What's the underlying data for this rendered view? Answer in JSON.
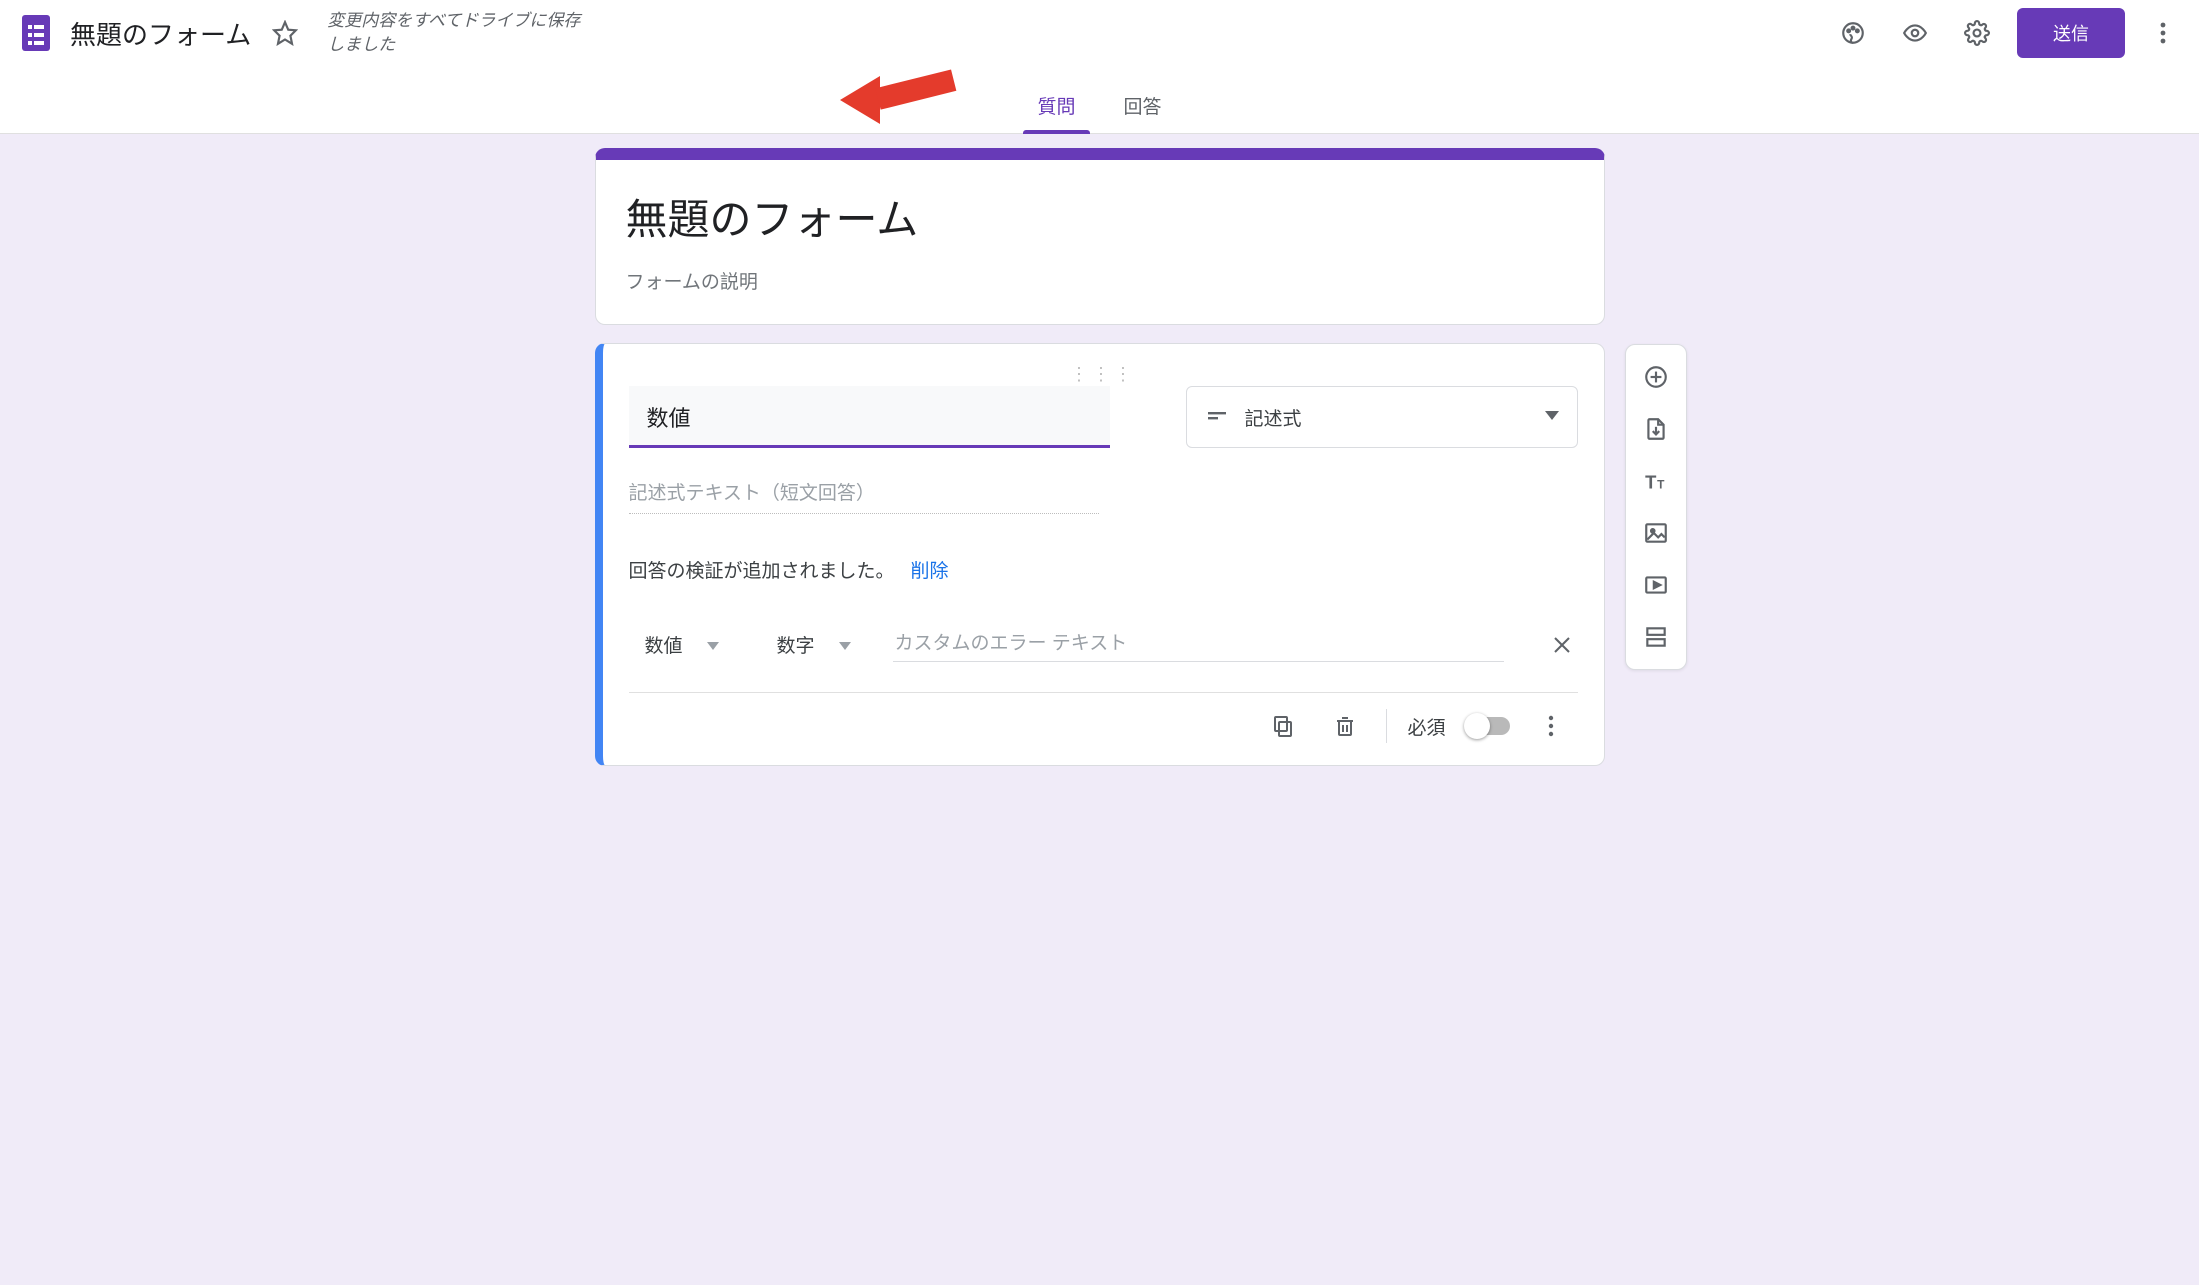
{
  "header": {
    "doc_title": "無題のフォーム",
    "save_status": "変更内容をすべてドライブに保存しました",
    "send_label": "送信"
  },
  "tabs": {
    "questions": "質問",
    "responses": "回答"
  },
  "form": {
    "title": "無題のフォーム",
    "description": "フォームの説明"
  },
  "question": {
    "title": "数値",
    "type_label": "記述式",
    "short_answer_placeholder": "記述式テキスト（短文回答）",
    "validation_added": "回答の検証が追加されました。",
    "validation_delete": "削除",
    "validation_kind": "数値",
    "validation_op": "数字",
    "error_placeholder": "カスタムのエラー テキスト",
    "required_label": "必須"
  },
  "icons": {
    "palette": "palette-icon",
    "preview": "eye-icon",
    "settings": "gear-icon",
    "more": "more-vert-icon",
    "star": "star-icon",
    "copy": "copy-icon",
    "delete": "trash-icon",
    "qmore": "more-vert-icon",
    "short_text": "short-text-icon"
  },
  "side_toolbar": {
    "add_question": "add-circle-icon",
    "import_questions": "import-icon",
    "add_title": "title-icon",
    "add_image": "image-icon",
    "add_video": "video-icon",
    "add_section": "section-icon"
  }
}
